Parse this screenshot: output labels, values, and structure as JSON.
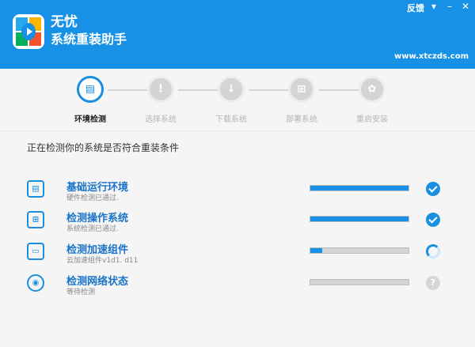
{
  "header": {
    "title": "无忧",
    "subtitle": "系统重装助手",
    "feedback": "反馈",
    "website": "www.xtczds.com"
  },
  "steps": [
    {
      "label": "环境检测",
      "active": true,
      "icon": "monitor-icon",
      "glyph": "▤"
    },
    {
      "label": "选择系统",
      "active": false,
      "icon": "document-icon",
      "glyph": "!"
    },
    {
      "label": "下载系统",
      "active": false,
      "icon": "download-icon",
      "glyph": "↓"
    },
    {
      "label": "部署系统",
      "active": false,
      "icon": "windows-icon",
      "glyph": "⊞"
    },
    {
      "label": "重启安装",
      "active": false,
      "icon": "gear-icon",
      "glyph": "✿"
    }
  ],
  "status_text": "正在检测你的系统是否符合重装条件",
  "checks": [
    {
      "title": "基础运行环境",
      "subtitle": "硬件检测已通过.",
      "progress": 1.0,
      "state": "done",
      "icon": "computer-icon"
    },
    {
      "title": "检测操作系统",
      "subtitle": "系统检测已通过.",
      "progress": 1.0,
      "state": "done",
      "icon": "windows-icon"
    },
    {
      "title": "检测加速组件",
      "subtitle": "云加速组件v1d1. d11",
      "progress": 0.12,
      "state": "loading",
      "icon": "monitor-icon"
    },
    {
      "title": "检测网络状态",
      "subtitle": "等待检测",
      "progress": 0.0,
      "state": "waiting",
      "icon": "globe-icon"
    }
  ],
  "colors": {
    "accent": "#1691e6",
    "inactive": "#d4d4d4"
  }
}
